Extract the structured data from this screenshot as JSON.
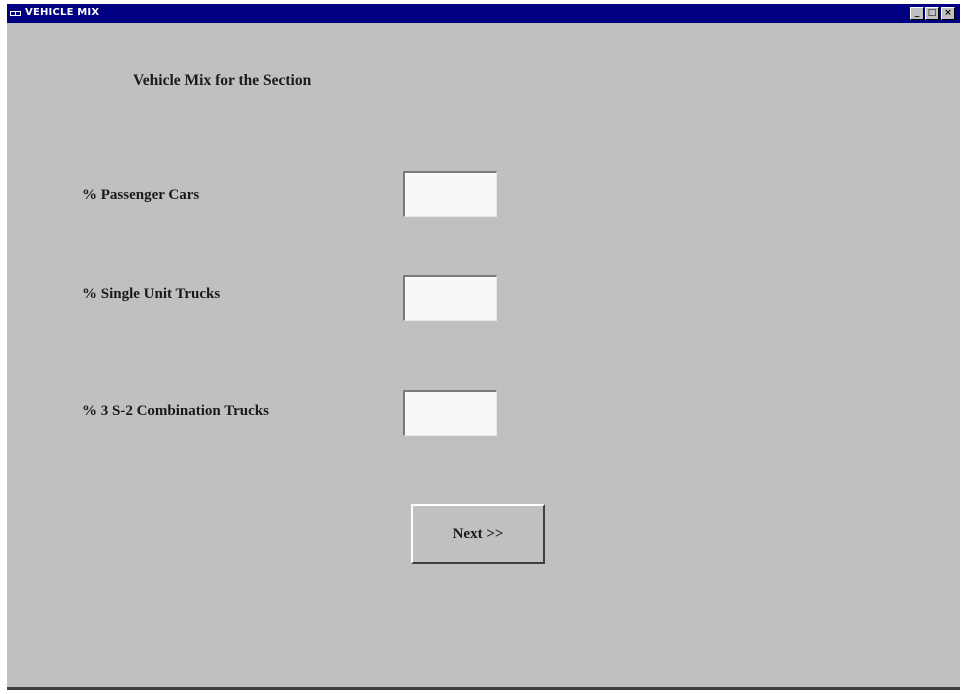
{
  "window": {
    "title": "VEHICLE MIX",
    "controls": {
      "minimize": "_",
      "maximize": "□",
      "close": "×"
    },
    "titlebar_color": "#000080",
    "background_color": "#c0c0c0"
  },
  "form": {
    "heading": "Vehicle Mix for the Section",
    "fields": [
      {
        "label": "% Passenger Cars",
        "value": ""
      },
      {
        "label": "% Single Unit Trucks",
        "value": ""
      },
      {
        "label": "% 3 S-2 Combination Trucks",
        "value": ""
      }
    ],
    "next_button": "Next >>"
  }
}
